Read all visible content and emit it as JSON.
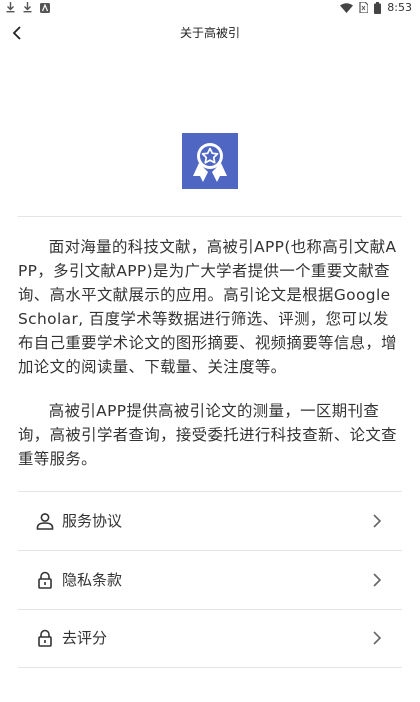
{
  "status_bar": {
    "time": "8:53"
  },
  "header": {
    "title": "关于高被引"
  },
  "about": {
    "paragraph1": "面对海量的科技文献，高被引APP(也称高引文献APP，多引文献APP)是为广大学者提供一个重要文献查询、高水平文献展示的应用。高引论文是根据Google Scholar, 百度学术等数据进行筛选、评测，您可以发布自己重要学术论文的图形摘要、视频摘要等信息，增加论文的阅读量、下载量、关注度等。",
    "paragraph2": "高被引APP提供高被引论文的测量，一区期刊查询，高被引学者查询，接受委托进行科技查新、论文查重等服务。"
  },
  "menu": {
    "items": [
      {
        "label": "服务协议",
        "icon": "user-icon"
      },
      {
        "label": "隐私条款",
        "icon": "lock-icon"
      },
      {
        "label": "去评分",
        "icon": "lock-icon"
      }
    ]
  },
  "colors": {
    "brand": "#4f66c3"
  }
}
